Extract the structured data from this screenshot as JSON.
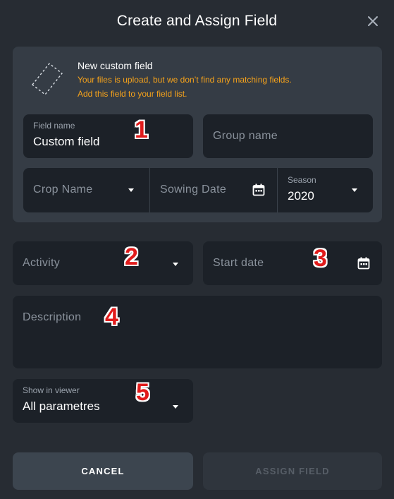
{
  "dialog": {
    "title": "Create and Assign Field"
  },
  "info": {
    "title": "New custom field",
    "message_line1": "Your files is upload, but we don’t find any matching fields.",
    "message_line2": "Add this field to your field list."
  },
  "fields": {
    "field_name": {
      "label": "Field name",
      "value": "Custom field"
    },
    "group_name": {
      "placeholder": "Group name"
    },
    "crop_name": {
      "placeholder": "Crop Name"
    },
    "sowing_date": {
      "placeholder": "Sowing Date"
    },
    "season": {
      "label": "Season",
      "value": "2020"
    },
    "activity": {
      "placeholder": "Activity"
    },
    "start_date": {
      "placeholder": "Start date"
    },
    "description": {
      "placeholder": "Description"
    },
    "show_in_viewer": {
      "label": "Show in viewer",
      "value": "All parametres"
    }
  },
  "markers": [
    "1",
    "2",
    "3",
    "4",
    "5"
  ],
  "buttons": {
    "cancel": "CANCEL",
    "assign": "ASSIGN FIELD"
  },
  "colors": {
    "background": "#272c33",
    "panel": "#353c45",
    "input": "#1c2128",
    "warning": "#f5a21b",
    "marker": "#e11b1b"
  },
  "icons": [
    "close-icon",
    "dashed-field-icon",
    "chevron-down-icon",
    "calendar-icon"
  ]
}
